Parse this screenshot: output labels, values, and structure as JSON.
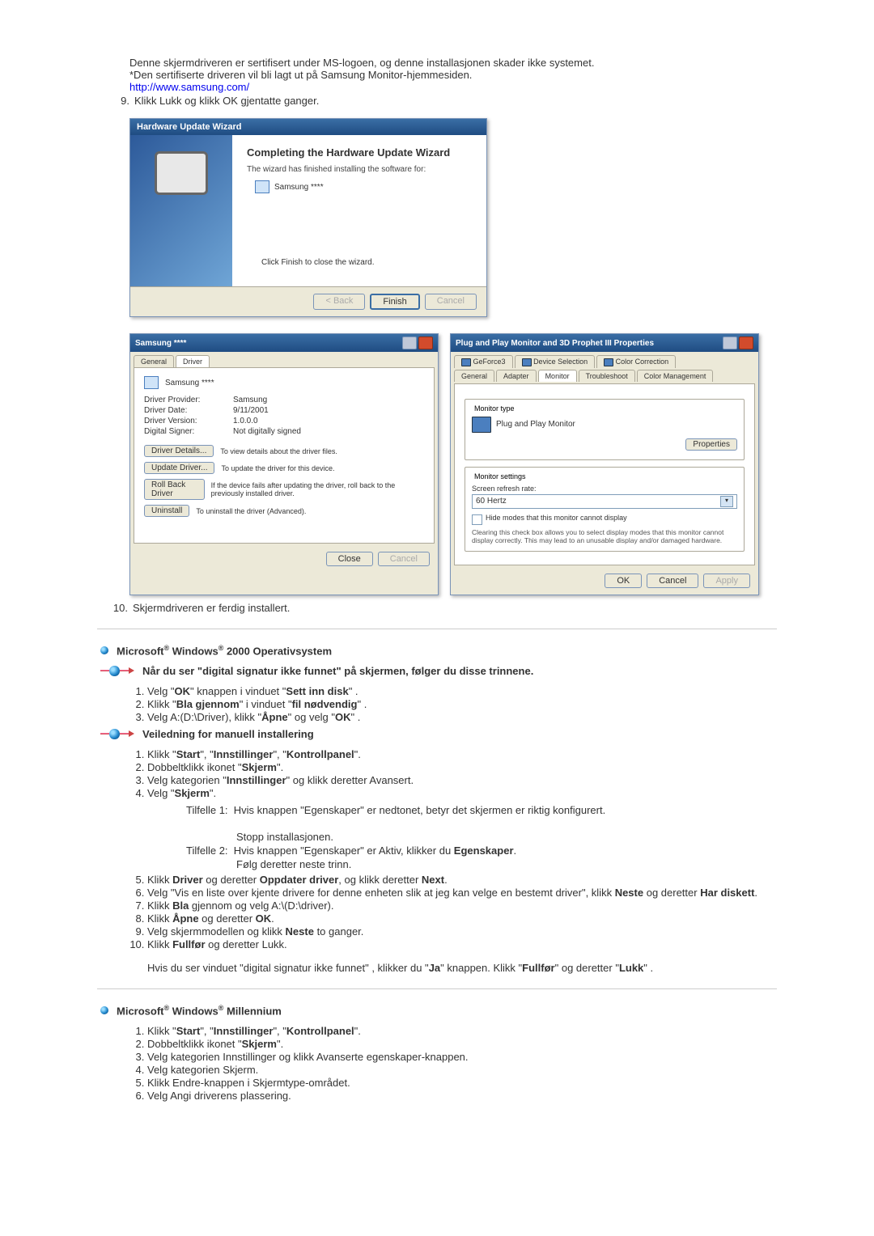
{
  "intro": {
    "lines": [
      "Denne skjermdriveren er sertifisert under MS-logoen, og denne installasjonen skader ikke systemet.",
      "*Den sertifiserte driveren vil bli lagt ut på Samsung Monitor-hjemmesiden."
    ],
    "link": "http://www.samsung.com/",
    "step9_num": "9.",
    "step9": "Klikk Lukk og klikk OK gjentatte ganger."
  },
  "wizard": {
    "titlebar": "Hardware Update Wizard",
    "heading": "Completing the Hardware Update Wizard",
    "sub": "The wizard has finished installing the software for:",
    "device": "Samsung ****",
    "note": "Click Finish to close the wizard.",
    "btn_back": "< Back",
    "btn_finish": "Finish",
    "btn_cancel": "Cancel"
  },
  "drvprop": {
    "title": "Samsung ****",
    "tab_general": "General",
    "tab_driver": "Driver",
    "device": "Samsung ****",
    "kv": [
      [
        "Driver Provider:",
        "Samsung"
      ],
      [
        "Driver Date:",
        "9/11/2001"
      ],
      [
        "Driver Version:",
        "1.0.0.0"
      ],
      [
        "Digital Signer:",
        "Not digitally signed"
      ]
    ],
    "btns": [
      [
        "Driver Details...",
        "To view details about the driver files."
      ],
      [
        "Update Driver...",
        "To update the driver for this device."
      ],
      [
        "Roll Back Driver",
        "If the device fails after updating the driver, roll back to the previously installed driver."
      ],
      [
        "Uninstall",
        "To uninstall the driver (Advanced)."
      ]
    ],
    "close": "Close",
    "cancel": "Cancel"
  },
  "pnp": {
    "title": "Plug and Play Monitor and 3D Prophet III Properties",
    "tabs_top": [
      "GeForce3",
      "Device Selection",
      "Color Correction"
    ],
    "tabs_bottom": [
      "General",
      "Adapter",
      "Monitor",
      "Troubleshoot",
      "Color Management"
    ],
    "monitor_type_label": "Monitor type",
    "monitor_type": "Plug and Play Monitor",
    "properties": "Properties",
    "settings_label": "Monitor settings",
    "refresh_label": "Screen refresh rate:",
    "refresh_value": "60 Hertz",
    "hide_check": "Hide modes that this monitor cannot display",
    "hide_desc": "Clearing this check box allows you to select display modes that this monitor cannot display correctly. This may lead to an unusable display and/or damaged hardware.",
    "ok": "OK",
    "cancel": "Cancel",
    "apply": "Apply"
  },
  "step10_num": "10.",
  "step10": "Skjermdriveren er ferdig installert.",
  "win2000": {
    "heading_pre": "Microsoft",
    "heading_mid": " Windows",
    "heading_post": " 2000 Operativsystem",
    "sig_heading": "Når du ser \"digital signatur ikke funnet\" på skjermen, følger du disse trinnene.",
    "sig_steps": [
      "Velg \"<b>OK</b>\" knappen i vinduet \"<b>Sett inn disk</b>\" .",
      "Klikk \"<b>Bla gjennom</b>\" i vinduet \"<b>fil nødvendig</b>\" .",
      "Velg A:(D:\\Driver), klikk \"<b>Åpne</b>\" og velg \"<b>OK</b>\" ."
    ],
    "manual_heading": "Veiledning for manuell installering",
    "manual_steps_1_4": [
      "Klikk \"<b>Start</b>\", \"<b>Innstillinger</b>\", \"<b>Kontrollpanel</b>\".",
      "Dobbeltklikk ikonet \"<b>Skjerm</b>\".",
      "Velg kategorien \"<b>Innstillinger</b>\" og klikk deretter Avansert.",
      "Velg \"<b>Skjerm</b>\"."
    ],
    "tilfelle1_num": "Tilfelle 1:",
    "tilfelle1": "Hvis knappen \"Egenskaper\" er nedtonet, betyr det skjermen er riktig konfigurert.",
    "stopp": "Stopp installasjonen.",
    "tilfelle2_num": "Tilfelle 2:",
    "tilfelle2": "Hvis knappen \"Egenskaper\" er Aktiv, klikker du <b>Egenskaper</b>.",
    "folg": "Følg deretter neste trinn.",
    "manual_steps_5_10": [
      "Klikk <b>Driver</b> og deretter <b>Oppdater driver</b>, og klikk deretter <b>Next</b>.",
      "Velg \"Vis en liste over kjente drivere for denne enheten slik at jeg kan velge en bestemt driver\", klikk <b>Neste</b> og deretter <b>Har diskett</b>.",
      "Klikk <b>Bla</b> gjennom og velg A:\\(D:\\driver).",
      "Klikk <b>Åpne</b> og deretter <b>OK</b>.",
      "Velg skjermmodellen og klikk <b>Neste</b> to ganger.",
      "Klikk <b>Fullfør</b> og deretter Lukk."
    ],
    "trailer": "Hvis du ser vinduet \"digital signatur ikke funnet\" , klikker du \"<b>Ja</b>\" knappen. Klikk \"<b>Fullfør</b>\" og deretter \"<b>Lukk</b>\" ."
  },
  "winme": {
    "heading_pre": "Microsoft",
    "heading_mid": " Windows",
    "heading_post": " Millennium",
    "steps": [
      "Klikk \"<b>Start</b>\", \"<b>Innstillinger</b>\", \"<b>Kontrollpanel</b>\".",
      "Dobbeltklikk ikonet \"<b>Skjerm</b>\".",
      "Velg kategorien Innstillinger og klikk Avanserte egenskaper-knappen.",
      "Velg kategorien Skjerm.",
      "Klikk Endre-knappen i Skjermtype-området.",
      "Velg Angi driverens plassering."
    ]
  }
}
